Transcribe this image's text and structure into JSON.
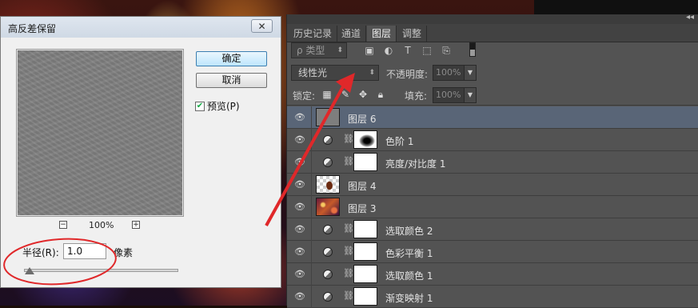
{
  "dialog": {
    "title": "高反差保留",
    "close_glyph": "✕",
    "ok_label": "确定",
    "cancel_label": "取消",
    "preview_label": "预览(P)",
    "preview_checked": true,
    "zoom_out": "−",
    "zoom_in": "+",
    "zoom_level": "100%",
    "radius_label": "半径(R):",
    "radius_value": "1.0",
    "radius_unit": "像素"
  },
  "panel": {
    "collapse_glyph": "◂◂",
    "tabs": [
      "历史记录",
      "通道",
      "图层",
      "调整"
    ],
    "active_tab": "图层",
    "kind_filter": "ρ 类型",
    "filter_icons": [
      "image-filter-icon",
      "adjustment-filter-icon",
      "text-filter-icon",
      "shape-filter-icon",
      "smart-object-filter-icon"
    ],
    "blend_mode": "线性光",
    "opacity_label": "不透明度:",
    "opacity_value": "100%",
    "lock_label": "锁定:",
    "fill_label": "填充:",
    "fill_value": "100%",
    "layers": [
      {
        "name": "图层 6",
        "kind": "pixel",
        "thumb": "gray",
        "selected": true
      },
      {
        "name": "色阶 1",
        "kind": "adjustment",
        "thumb": "levels"
      },
      {
        "name": "亮度/对比度 1",
        "kind": "adjustment",
        "thumb": "white"
      },
      {
        "name": "图层 4",
        "kind": "pixel",
        "thumb": "checker"
      },
      {
        "name": "图层 3",
        "kind": "pixel",
        "thumb": "scene"
      },
      {
        "name": "选取颜色 2",
        "kind": "adjustment",
        "thumb": "white"
      },
      {
        "name": "色彩平衡 1",
        "kind": "adjustment",
        "thumb": "white"
      },
      {
        "name": "选取颜色 1",
        "kind": "adjustment",
        "thumb": "white"
      },
      {
        "name": "渐变映射 1",
        "kind": "adjustment",
        "thumb": "white"
      }
    ]
  },
  "colors": {
    "annotation": "#e0282a",
    "panel_bg": "#535353",
    "selected_layer": "#596577"
  }
}
